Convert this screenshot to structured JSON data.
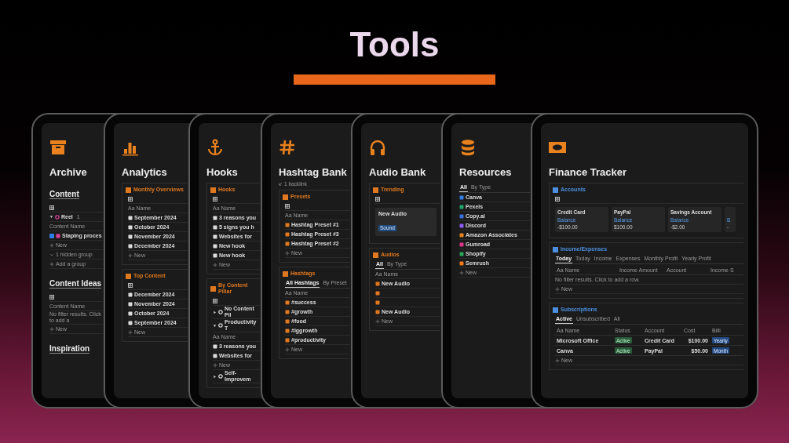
{
  "title": "Tools",
  "pages": [
    {
      "title": "Archive",
      "blocks": [
        {
          "kind": "heading",
          "text": "Content"
        },
        {
          "kind": "icon"
        },
        {
          "kind": "group",
          "text": "Reel",
          "count": "1",
          "expanded": true
        },
        {
          "kind": "header",
          "text": "Content Name"
        },
        {
          "kind": "item",
          "text": "Staping proces",
          "checked": true
        },
        {
          "kind": "new",
          "text": "New"
        },
        {
          "kind": "hidden",
          "text": "1 hidden group"
        },
        {
          "kind": "new",
          "text": "Add a group"
        },
        {
          "kind": "heading",
          "text": "Content Ideas"
        },
        {
          "kind": "icon"
        },
        {
          "kind": "header",
          "text": "Content Name"
        },
        {
          "kind": "note",
          "text": "No filter results. Click to add a"
        },
        {
          "kind": "new",
          "text": "New"
        },
        {
          "kind": "heading",
          "text": "Inspiration"
        }
      ]
    },
    {
      "title": "Analytics",
      "blocks": [
        {
          "kind": "section",
          "title": "Monthly Overviews",
          "color": "#e0781f",
          "rows": [
            {
              "kind": "icon"
            },
            {
              "kind": "header",
              "text": "Aa Name"
            },
            {
              "kind": "item",
              "text": "September 2024"
            },
            {
              "kind": "item",
              "text": "October 2024"
            },
            {
              "kind": "item",
              "text": "November 2024"
            },
            {
              "kind": "item",
              "text": "December 2024"
            },
            {
              "kind": "new",
              "text": "New"
            }
          ]
        },
        {
          "kind": "section",
          "title": "Top Content",
          "color": "#e0781f",
          "rows": [
            {
              "kind": "icon"
            },
            {
              "kind": "item",
              "text": "December 2024"
            },
            {
              "kind": "item",
              "text": "November 2024"
            },
            {
              "kind": "item",
              "text": "October 2024"
            },
            {
              "kind": "item",
              "text": "September 2024"
            },
            {
              "kind": "new",
              "text": "New"
            }
          ]
        }
      ]
    },
    {
      "title": "Hooks",
      "blocks": [
        {
          "kind": "section",
          "title": "Hooks",
          "color": "#e0781f",
          "rows": [
            {
              "kind": "icon"
            },
            {
              "kind": "header",
              "text": "Aa Name"
            },
            {
              "kind": "item",
              "text": "3 reasons you"
            },
            {
              "kind": "item",
              "text": "5 signs you h"
            },
            {
              "kind": "item",
              "text": "Websites for"
            },
            {
              "kind": "item",
              "text": "New hook"
            },
            {
              "kind": "item",
              "text": "New hook"
            },
            {
              "kind": "new",
              "text": "New"
            }
          ]
        },
        {
          "kind": "section",
          "title": "By Content Pillar",
          "color": "#e0781f",
          "rows": [
            {
              "kind": "icon"
            },
            {
              "kind": "group",
              "text": "No Content Pil",
              "expanded": false
            },
            {
              "kind": "group",
              "text": "Productivity T",
              "expanded": true
            },
            {
              "kind": "header",
              "text": "Aa Name"
            },
            {
              "kind": "item",
              "text": "3 reasons you"
            },
            {
              "kind": "item",
              "text": "Websites for"
            },
            {
              "kind": "new",
              "text": "New"
            },
            {
              "kind": "group",
              "text": "Self-Improvem",
              "expanded": false
            }
          ]
        }
      ]
    },
    {
      "title": "Hashtag Bank",
      "backlink": "1 backlink",
      "blocks": [
        {
          "kind": "section",
          "title": "Presets",
          "color": "#e0781f",
          "rows": [
            {
              "kind": "icon"
            },
            {
              "kind": "header",
              "text": "Aa Name"
            },
            {
              "kind": "item",
              "text": "Hashtag Preset #1"
            },
            {
              "kind": "item",
              "text": "Hashtag Preset #3"
            },
            {
              "kind": "item",
              "text": "Hashtag Preset #2"
            },
            {
              "kind": "new",
              "text": "New"
            }
          ]
        },
        {
          "kind": "section",
          "title": "Hashtags",
          "color": "#e0781f",
          "rows": [
            {
              "kind": "tabs",
              "tabs": [
                {
                  "label": "All Hashtags",
                  "selected": true
                },
                {
                  "label": "By Preset",
                  "selected": false
                }
              ]
            },
            {
              "kind": "header",
              "text": "Aa Name"
            },
            {
              "kind": "item",
              "text": "#success"
            },
            {
              "kind": "item",
              "text": "#growth"
            },
            {
              "kind": "item",
              "text": "#food"
            },
            {
              "kind": "item",
              "text": "#iggrowth"
            },
            {
              "kind": "item",
              "text": "#productivity"
            },
            {
              "kind": "new",
              "text": "New"
            }
          ]
        }
      ]
    },
    {
      "title": "Audio Bank",
      "blocks": [
        {
          "kind": "section",
          "title": "Trending",
          "color": "#e0781f",
          "rows": [
            {
              "kind": "icon"
            },
            {
              "kind": "card",
              "text": "New Audio",
              "tag": "Sound"
            }
          ]
        },
        {
          "kind": "section",
          "title": "Audios",
          "color": "#e0781f",
          "rows": [
            {
              "kind": "tabs",
              "tabs": [
                {
                  "label": "All",
                  "selected": true
                },
                {
                  "label": "By Type",
                  "selected": false
                }
              ]
            },
            {
              "kind": "header",
              "text": "Aa Name"
            },
            {
              "kind": "item",
              "text": "New Audio"
            },
            {
              "kind": "item"
            },
            {
              "kind": "item"
            },
            {
              "kind": "item",
              "text": "New Audio"
            },
            {
              "kind": "new",
              "text": "New"
            }
          ]
        }
      ]
    },
    {
      "title": "Resources",
      "blocks": [
        {
          "kind": "tabs",
          "tabs": [
            {
              "label": "All",
              "selected": true
            },
            {
              "label": "By Type",
              "selected": false
            }
          ]
        },
        {
          "kind": "item",
          "text": "Canva",
          "color": "#2f7fe8"
        },
        {
          "kind": "item",
          "text": "Pexels",
          "color": "#1ea36b"
        },
        {
          "kind": "item",
          "text": "Copy.ai",
          "color": "#3b6fe0"
        },
        {
          "kind": "item",
          "text": "Discord",
          "color": "#8a5cf5"
        },
        {
          "kind": "item",
          "text": "Amazon Associates",
          "color": "#e8811e"
        },
        {
          "kind": "item",
          "text": "Gumroad",
          "color": "#e0348c"
        },
        {
          "kind": "item",
          "text": "Shopify",
          "color": "#2aa55a"
        },
        {
          "kind": "item",
          "text": "Semrush",
          "color": "#f07a1a"
        },
        {
          "kind": "new",
          "text": "New"
        }
      ]
    },
    {
      "title": "Finance Tracker",
      "blocks": [
        {
          "kind": "section",
          "title": "Accounts",
          "color": "#4a8fe0",
          "rows": [
            {
              "kind": "icon"
            },
            {
              "kind": "cards",
              "cards": [
                {
                  "title": "Credit Card",
                  "label": "Balance",
                  "value": "-$100.00"
                },
                {
                  "title": "PayPal",
                  "label": "Balance",
                  "value": "$100.00"
                },
                {
                  "title": "Savings Account",
                  "label": "Balance",
                  "value": "-$2.00"
                },
                {
                  "label": "B",
                  "value": "-"
                }
              ]
            }
          ]
        },
        {
          "kind": "section",
          "title": "Income/Expenses",
          "color": "#4a8fe0",
          "rows": [
            {
              "kind": "tabs",
              "tabs": [
                {
                  "label": "Today",
                  "selected": true
                },
                {
                  "label": "Today",
                  "selected": false
                },
                {
                  "label": "Income",
                  "selected": false
                },
                {
                  "label": "Expenses",
                  "selected": false
                },
                {
                  "label": "Monthly Profit",
                  "selected": false
                },
                {
                  "label": "Yearly Profit",
                  "selected": false
                }
              ]
            },
            {
              "kind": "table",
              "columns": [
                "Aa Name",
                "Income Amount",
                "Account",
                "Income S"
              ]
            },
            {
              "kind": "note",
              "text": "No filter results. Click to add a row."
            },
            {
              "kind": "new",
              "text": "New"
            }
          ]
        },
        {
          "kind": "section",
          "title": "Subscriptions",
          "color": "#4a8fe0",
          "rows": [
            {
              "kind": "tabs",
              "tabs": [
                {
                  "label": "Active",
                  "selected": true
                },
                {
                  "label": "Unsubscribed",
                  "selected": false
                },
                {
                  "label": "All",
                  "selected": false
                }
              ]
            },
            {
              "kind": "table",
              "columns": [
                "Aa Name",
                "Status",
                "Account",
                "Cost",
                "Billi"
              ],
              "rows": [
                {
                  "cells": [
                    "Microsoft Office",
                    "Active",
                    "Credit Card",
                    "$100.00",
                    "Yearly"
                  ]
                },
                {
                  "cells": [
                    "Canva",
                    "Active",
                    "PayPal",
                    "$50.00",
                    "Month"
                  ]
                }
              ]
            },
            {
              "kind": "new",
              "text": "New"
            }
          ]
        }
      ]
    }
  ]
}
